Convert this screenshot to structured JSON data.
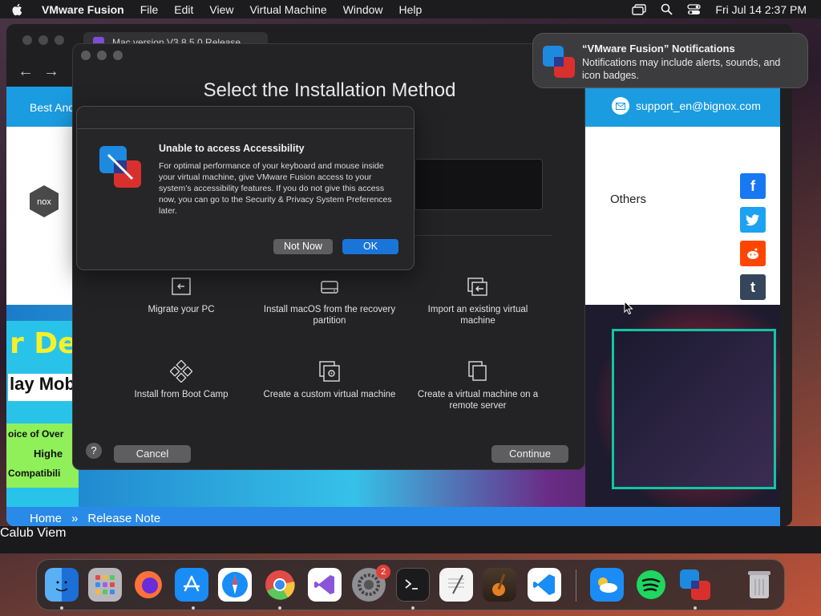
{
  "menubar": {
    "app_name": "VMware Fusion",
    "menus": [
      "File",
      "Edit",
      "View",
      "Virtual Machine",
      "Window",
      "Help"
    ],
    "clock": "Fri Jul 14  2:37 PM"
  },
  "browser": {
    "tab_title": "Mac version V3.8.5.0 Release",
    "site": {
      "topbar_left": "Best And",
      "support_email": "support_en@bignox.com",
      "nav_partial": "l",
      "nav_others": "Others",
      "banner_text_1": "r Deta",
      "banner_text_2": "lay Mob",
      "banner_text_3": "oice of Over",
      "banner_text_4": "Highe",
      "banner_text_5": "Compatibili",
      "breadcrumb_home": "Home",
      "breadcrumb_sep": "»",
      "breadcrumb_current": "Release Note"
    },
    "under_label": "Calub Viem"
  },
  "vm_window": {
    "title": "Select the Installation Method",
    "options": [
      {
        "label": "Migrate your PC",
        "icon": "migrate-pc-icon"
      },
      {
        "label": "Install macOS from the recovery partition",
        "icon": "disk-icon"
      },
      {
        "label": "Import an existing virtual machine",
        "icon": "import-vm-icon"
      },
      {
        "label": "Install from Boot Camp",
        "icon": "bootcamp-icon"
      },
      {
        "label": "Create a custom virtual machine",
        "icon": "custom-vm-icon"
      },
      {
        "label": "Create a virtual machine on a remote server",
        "icon": "remote-server-icon"
      }
    ],
    "help_label": "?",
    "cancel_label": "Cancel",
    "continue_label": "Continue"
  },
  "alert": {
    "heading": "Unable to access Accessibility",
    "body": "For optimal performance of your keyboard and mouse inside your virtual machine, give VMware Fusion access to your system’s accessibility features. If you do not give this access now, you can go to the Security & Privacy System Preferences later.",
    "not_now_label": "Not Now",
    "ok_label": "OK"
  },
  "notification": {
    "title": "“VMware Fusion” Notifications",
    "message": "Notifications may include alerts, sounds, and icon badges."
  },
  "dock": {
    "apps": [
      "Finder",
      "Launchpad",
      "Firefox",
      "App Store",
      "Safari",
      "Chrome",
      "Visual Studio",
      "System Preferences",
      "Terminal",
      "TextEdit",
      "GarageBand",
      "VS Code",
      "Weather",
      "Spotify",
      "VMware Fusion",
      "Trash"
    ],
    "settings_badge": "2"
  },
  "colors": {
    "accent_blue": "#1a75d9",
    "site_blue": "#1b9be0",
    "dialog_bg": "#262628",
    "window_bg": "#232325"
  }
}
